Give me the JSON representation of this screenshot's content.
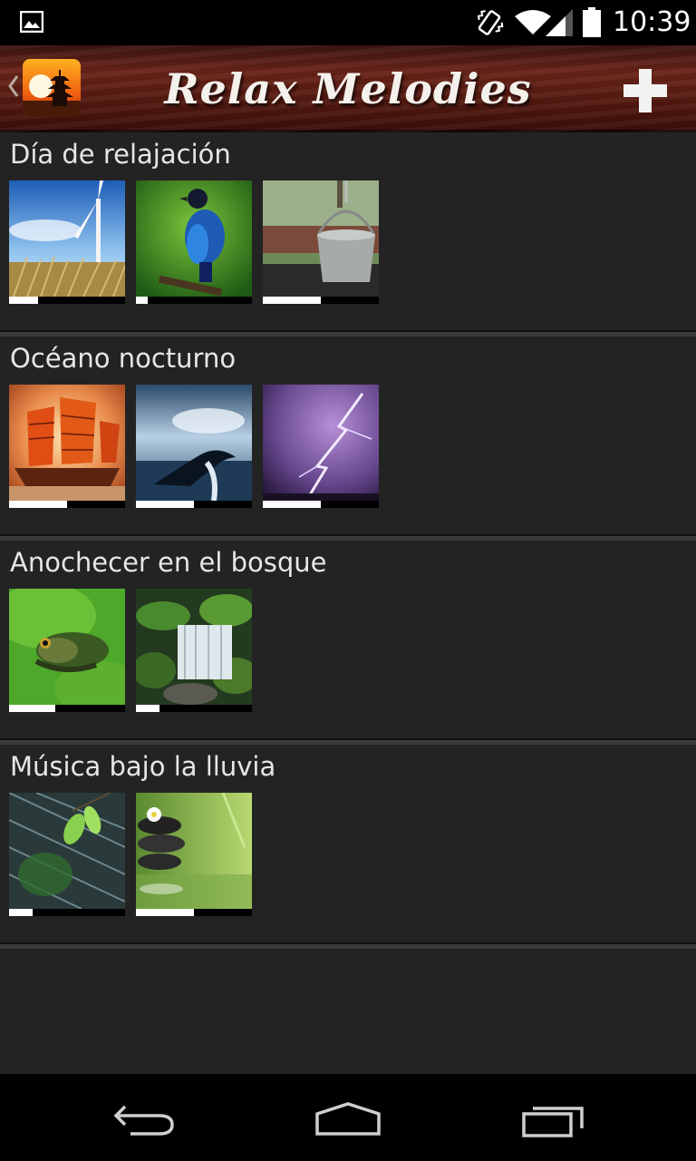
{
  "status_bar": {
    "time": "10:39",
    "icons": [
      "image-notification-icon",
      "vibrate-icon",
      "wifi-icon",
      "signal-icon",
      "battery-icon"
    ]
  },
  "action_bar": {
    "title": "Relax Melodies",
    "back_icon": "chevron-left-icon",
    "logo_icon": "pagoda-sunset-logo",
    "add_icon": "plus-icon"
  },
  "sections": [
    {
      "title": "Día de relajación",
      "tiles": [
        {
          "name": "wind-turbine-wheat",
          "progress": 0.25
        },
        {
          "name": "blue-bird",
          "progress": 0.1
        },
        {
          "name": "water-well-bucket",
          "progress": 0.5
        }
      ]
    },
    {
      "title": "Océano nocturno",
      "tiles": [
        {
          "name": "sailing-junk-ship",
          "progress": 0.5
        },
        {
          "name": "whale-tail",
          "progress": 0.5
        },
        {
          "name": "lightning-storm",
          "progress": 0.5
        }
      ]
    },
    {
      "title": "Anochecer en el bosque",
      "tiles": [
        {
          "name": "frog-on-lily-pad",
          "progress": 0.4
        },
        {
          "name": "forest-waterfall",
          "progress": 0.2
        }
      ]
    },
    {
      "title": "Música bajo la lluvia",
      "tiles": [
        {
          "name": "rain-leaves",
          "progress": 0.2
        },
        {
          "name": "zen-stones-water",
          "progress": 0.5
        }
      ]
    }
  ],
  "colors": {
    "background": "#232323",
    "action_bar": "#5a1c12",
    "progress_fill": "#ffffff"
  },
  "nav_bar": {
    "icons": [
      "back-icon",
      "home-icon",
      "recent-apps-icon"
    ]
  }
}
